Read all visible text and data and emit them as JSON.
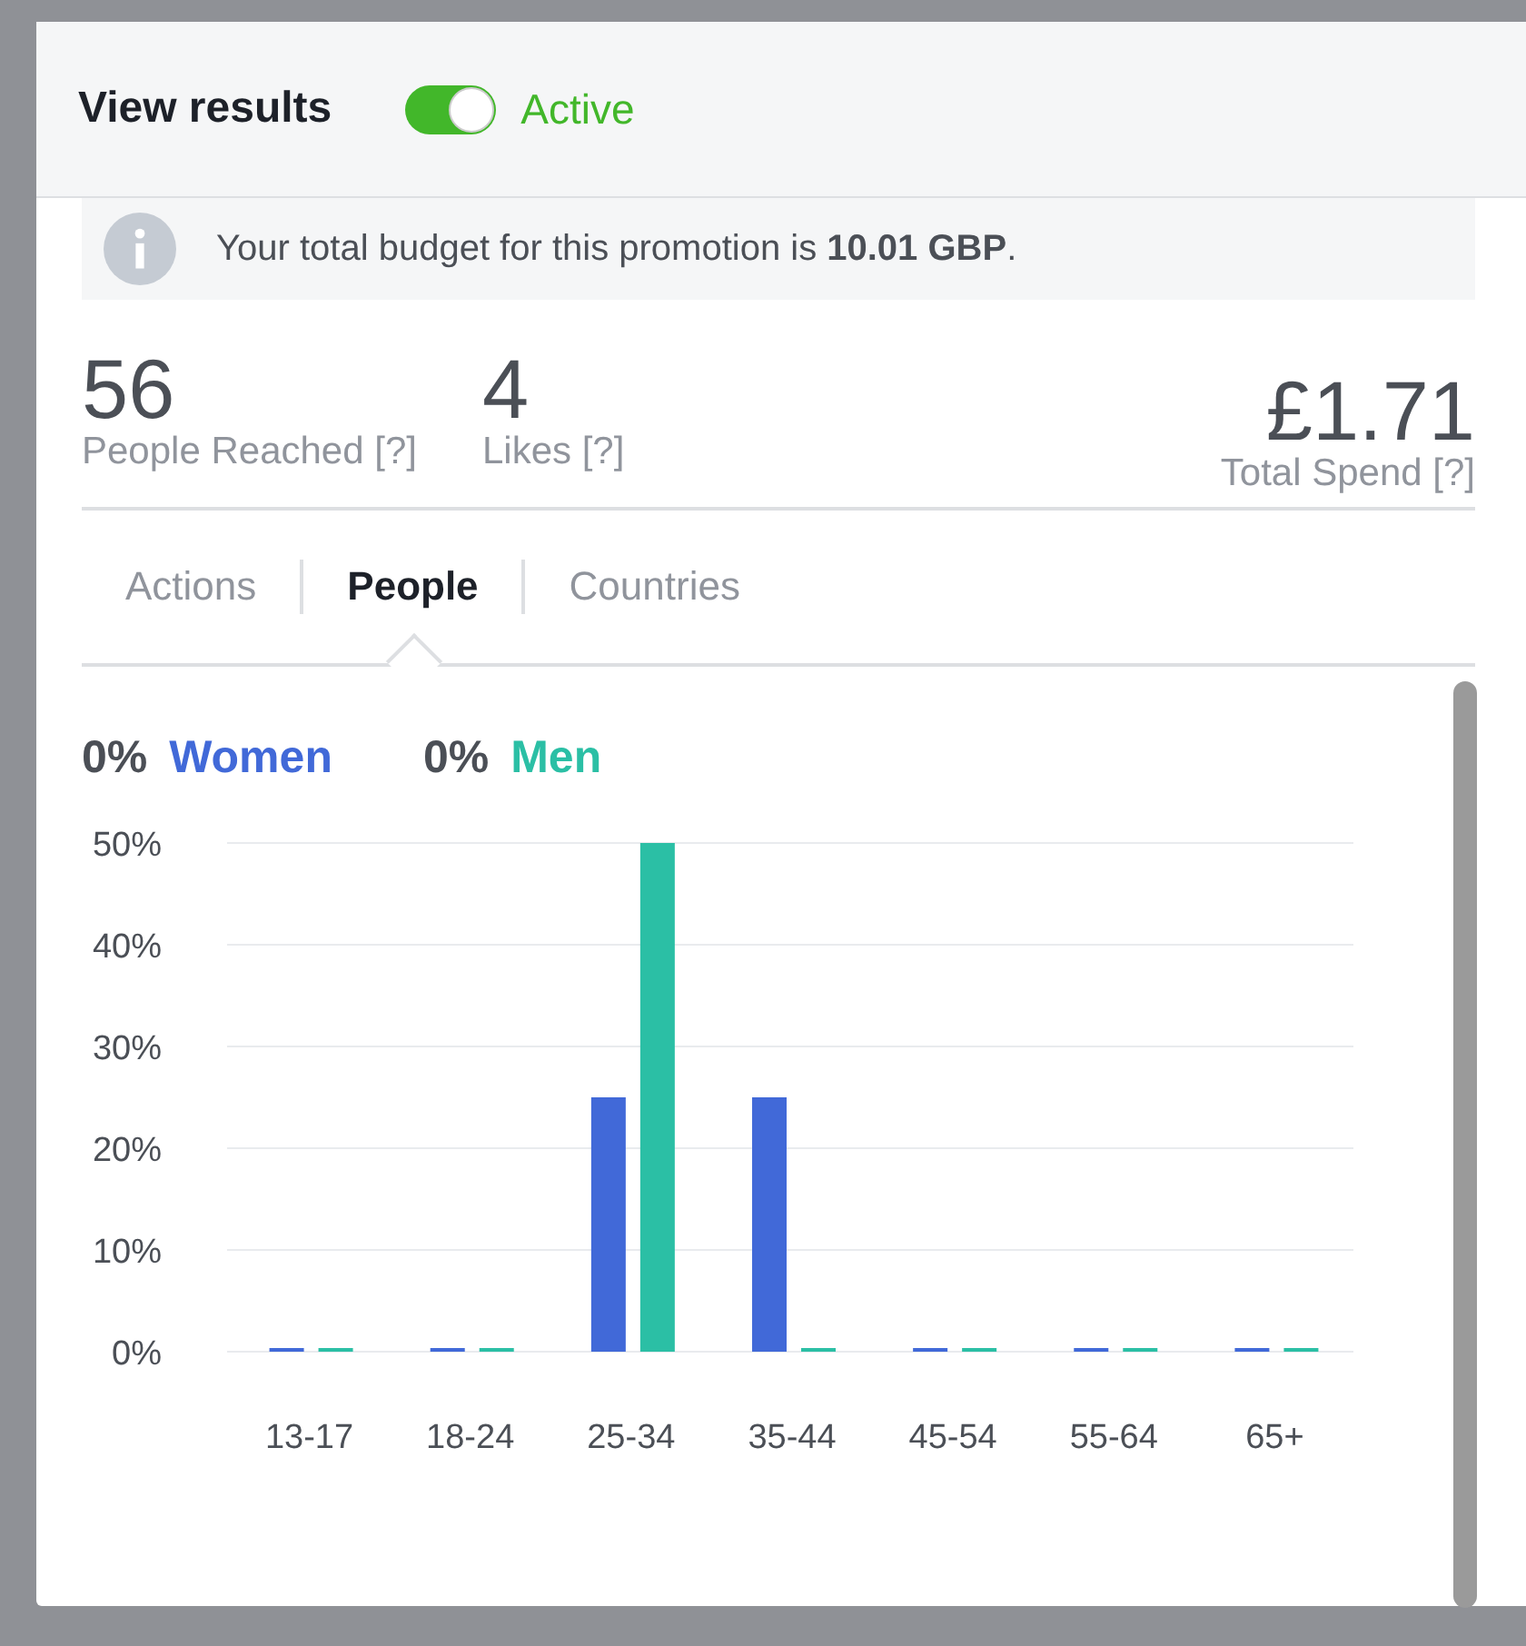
{
  "dialog": {
    "title": "View results",
    "toggle": {
      "on": true,
      "label": "Active"
    },
    "budget_notice": "Your total budget for this promotion is **10.01 GBP**.",
    "stats": [
      {
        "value": "56",
        "label": "People Reached [?]"
      },
      {
        "value": "4",
        "label": "Likes [?]"
      },
      {
        "value": "£1.71",
        "label": "Total Spend [?]"
      }
    ],
    "tabs": [
      {
        "label": "Actions",
        "selected": false
      },
      {
        "label": "People",
        "selected": true
      },
      {
        "label": "Countries",
        "selected": false
      }
    ],
    "legend_percents": [
      "0%",
      "0%"
    ],
    "chart_data": {
      "type": "bar",
      "categories": [
        "13-17",
        "18-24",
        "25-34",
        "35-44",
        "45-54",
        "55-64",
        "65+"
      ],
      "series": [
        {
          "name": "Women",
          "color": "#4169d8",
          "values": [
            0,
            0,
            25,
            25,
            0,
            0,
            0
          ]
        },
        {
          "name": "Men",
          "color": "#2bbfa5",
          "values": [
            0,
            0,
            50,
            0,
            0,
            0,
            0
          ]
        }
      ],
      "ylim": [
        0,
        50
      ],
      "yticks": [
        {
          "value": 0,
          "label": "0%"
        },
        {
          "value": 10,
          "label": "10%"
        },
        {
          "value": 20,
          "label": "20%"
        },
        {
          "value": 30,
          "label": "30%"
        },
        {
          "value": 40,
          "label": "40%"
        },
        {
          "value": 50,
          "label": "50%"
        }
      ],
      "grid": true
    }
  }
}
